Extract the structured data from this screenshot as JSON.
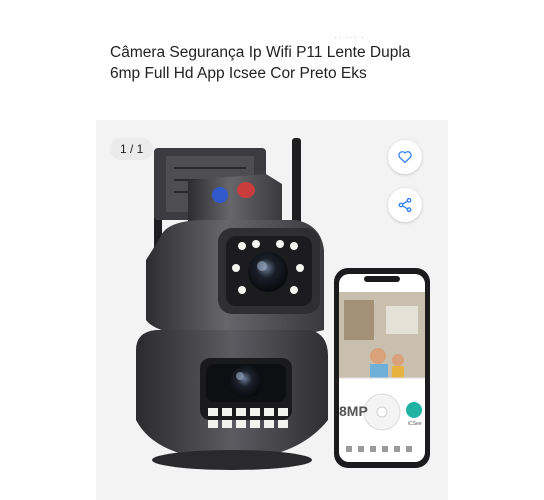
{
  "status_bar": {
    "text": "·· ··· ·"
  },
  "product": {
    "title": "Câmera Segurança Ip Wifi P11 Lente Dupla 6mp Full Hd App Icsee Cor Preto Eks"
  },
  "gallery": {
    "counter": "1 / 1",
    "favorite_icon": "heart-icon",
    "share_icon": "share-icon"
  },
  "image_overlay": {
    "resolution_badge": "8MP",
    "app_name": "iCSee"
  },
  "colors": {
    "accent": "#3483fa",
    "camera_body": "#4a4a4d",
    "background": "#f3f3f3"
  }
}
